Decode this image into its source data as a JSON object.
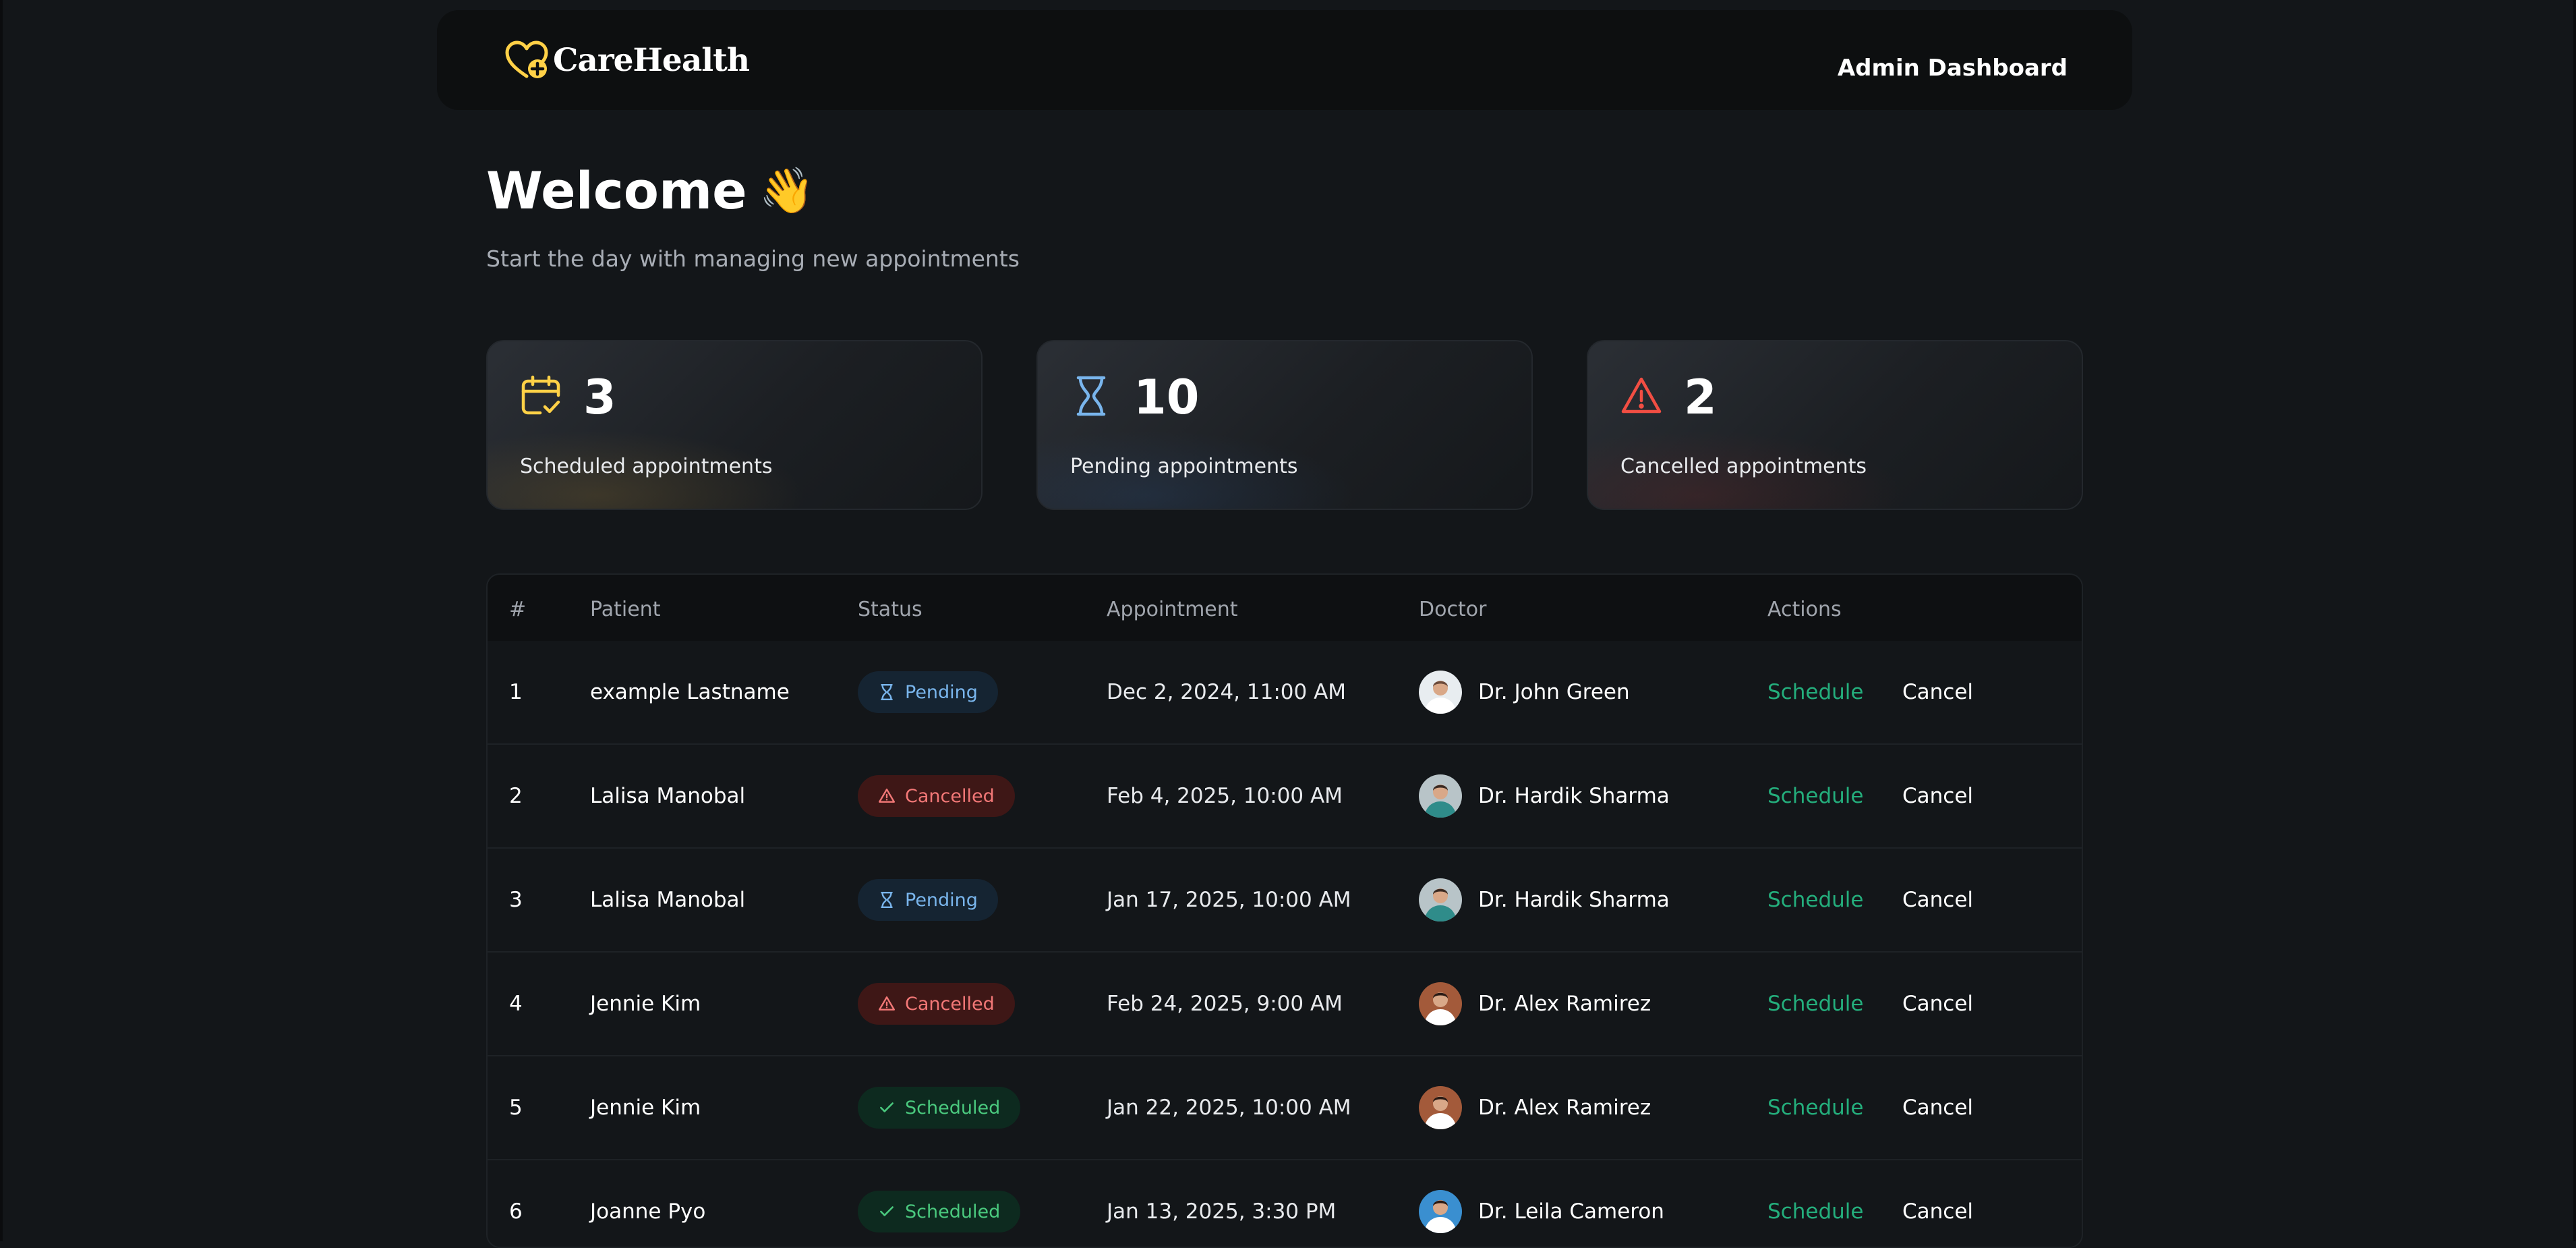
{
  "app": {
    "brand": "CareHealth",
    "header_title": "Admin Dashboard"
  },
  "welcome": {
    "title": "Welcome",
    "emoji": "👋",
    "subtitle": "Start the day with managing new appointments"
  },
  "stats": [
    {
      "count": "3",
      "label": "Scheduled appointments",
      "icon": "calendar-check-icon",
      "color": "#FFD147"
    },
    {
      "count": "10",
      "label": "Pending appointments",
      "icon": "hourglass-icon",
      "color": "#79B5EC"
    },
    {
      "count": "2",
      "label": "Cancelled appointments",
      "icon": "alert-triangle-icon",
      "color": "#F24E43"
    }
  ],
  "table": {
    "headers": [
      "#",
      "Patient",
      "Status",
      "Appointment",
      "Doctor",
      "Actions"
    ],
    "rows": [
      {
        "index": "1",
        "patient": "example Lastname",
        "status": "Pending",
        "status_type": "pending",
        "date": "Dec 2, 2024, 11:00 AM",
        "doctor": "Dr. John Green",
        "schedule": "Schedule",
        "cancel": "Cancel"
      },
      {
        "index": "2",
        "patient": "Lalisa Manobal",
        "status": "Cancelled",
        "status_type": "cancelled",
        "date": "Feb 4, 2025, 10:00 AM",
        "doctor": "Dr. Hardik Sharma",
        "schedule": "Schedule",
        "cancel": "Cancel"
      },
      {
        "index": "3",
        "patient": "Lalisa Manobal",
        "status": "Pending",
        "status_type": "pending",
        "date": "Jan 17, 2025, 10:00 AM",
        "doctor": "Dr. Hardik Sharma",
        "schedule": "Schedule",
        "cancel": "Cancel"
      },
      {
        "index": "4",
        "patient": "Jennie Kim",
        "status": "Cancelled",
        "status_type": "cancelled",
        "date": "Feb 24, 2025, 9:00 AM",
        "doctor": "Dr. Alex Ramirez",
        "schedule": "Schedule",
        "cancel": "Cancel"
      },
      {
        "index": "5",
        "patient": "Jennie Kim",
        "status": "Scheduled",
        "status_type": "scheduled",
        "date": "Jan 22, 2025, 10:00 AM",
        "doctor": "Dr. Alex Ramirez",
        "schedule": "Schedule",
        "cancel": "Cancel"
      },
      {
        "index": "6",
        "patient": "Joanne Pyo",
        "status": "Scheduled",
        "status_type": "scheduled",
        "date": "Jan 13, 2025, 3:30 PM",
        "doctor": "Dr. Leila Cameron",
        "schedule": "Schedule",
        "cancel": "Cancel"
      }
    ]
  },
  "colors": {
    "background": "#131619",
    "header_bg": "#0D0F10",
    "accent_green": "#24AE7C",
    "pending_blue": "#79B5EC",
    "cancelled_red": "#F37877",
    "scheduled_green": "#4AC97E",
    "brand_yellow": "#FFD147"
  }
}
